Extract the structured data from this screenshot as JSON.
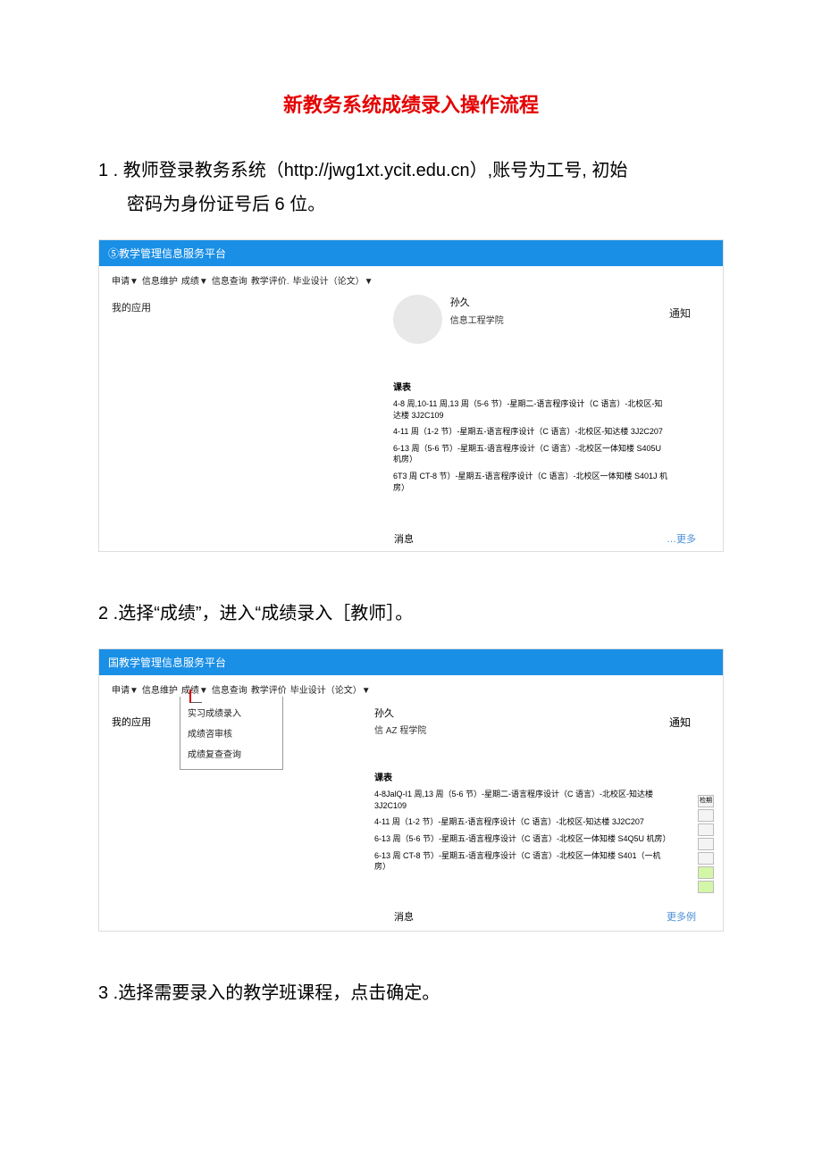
{
  "doc_title": "新教务系统成绩录入操作流程",
  "step1_line1": "1 . 教师登录教务系统（http://jwg1xt.ycit.edu.cn）,账号为工号, 初始",
  "step1_line2": "密码为身份证号后 6 位。",
  "shot1": {
    "header": "⑤教学管理信息服务平台",
    "menu": [
      "申请▼",
      "信息维护",
      "成绩▼",
      "信息查询",
      "教学评价.",
      "毕业设计（论文）▼"
    ],
    "my_app": "我的应用",
    "user_name": "孙久",
    "user_dept": "信息工程学院",
    "notice": "通知",
    "sched_h": "课表",
    "rows": [
      "4-8 周,10-11 周,13 周（5-6 节）-星期二-语言程序设计（C 语言）-北校区-知达楼 3J2C109",
      "4-11 周（1-2 节）-星期五-语言程序设计（C 语言）-北校区-知达楼 3J2C207",
      "6-13 周（5-6 节）-星期五-语言程序设计（C 语言）-北校区一体知楼 S405U 机房）",
      "6T3 周 CT-8 节）-星期五-语言程序设计（C 语言）-北校区一体知楼 S401J 机房）"
    ],
    "msg": "消息",
    "more": "…更多"
  },
  "step2": "2  .选择“成绩”，进入“成绩录入［教师］。",
  "shot2": {
    "header": "国教学管理信息服务平台",
    "menu": [
      "申请▼",
      "信息维护",
      "成绩▼",
      "信息查询",
      "教学评价",
      "毕业设计（论文）▼"
    ],
    "my_app": "我的应用",
    "dropdown": [
      "实习成绩录入",
      "成绩咨审核",
      "成绩复查查询"
    ],
    "user_name": "孙久",
    "user_dept": "信 AZ 程学院",
    "notice": "通知",
    "sched_h": "课表",
    "rows": [
      "4-8JalQ-I1 周,13 周（5-6 节）-星期二-语言程序设计（C 语言）-北校区-知达楼 3J2C109",
      "4-11 周（1-2 节）-星期五-语言程序设计（C 语言）-北校区-知达楼 3J2C207",
      "6-13 周（5-6 节）-星期五-语言程序设计（C 语言）-北校区一体知楼 S4Q5U 机房）",
      "6-13 周 CT-8 节）-星期五-语言程序设计（C 语言）-北校区一体知楼 S401（一机房）"
    ],
    "cal_top": "检期",
    "msg": "消息",
    "more": "更多例"
  },
  "step3": "3  .选择需要录入的教学班课程，点击确定。"
}
